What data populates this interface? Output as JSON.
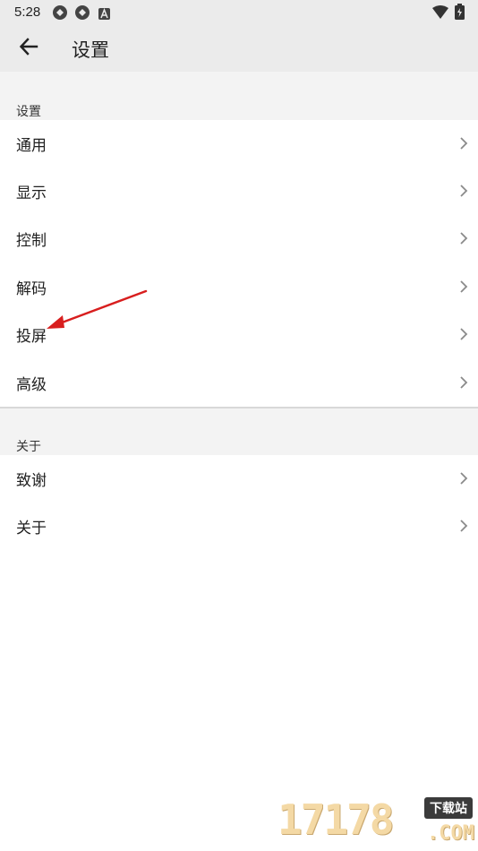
{
  "status_bar": {
    "time": "5:28",
    "icons": [
      "sync-icon",
      "sync-icon",
      "a-notification-icon",
      "wifi-icon",
      "battery-charging-icon"
    ]
  },
  "app_bar": {
    "back_icon": "arrow-left-icon",
    "title": "设置"
  },
  "sections": [
    {
      "header": "设置",
      "items": [
        {
          "label": "通用"
        },
        {
          "label": "显示"
        },
        {
          "label": "控制"
        },
        {
          "label": "解码"
        },
        {
          "label": "投屏"
        },
        {
          "label": "高级"
        }
      ]
    },
    {
      "header": "关于",
      "items": [
        {
          "label": "致谢"
        },
        {
          "label": "关于"
        }
      ]
    }
  ],
  "annotation": {
    "arrow_color": "#d81e1e",
    "points_to": "投屏"
  },
  "watermark": {
    "number": "17178",
    "badge": "下载站",
    "domain": ".COM"
  },
  "colors": {
    "app_bar_bg": "#ebebeb",
    "section_header_bg": "#f3f3f3",
    "text": "#212121",
    "chevron": "#8a8a8a"
  }
}
